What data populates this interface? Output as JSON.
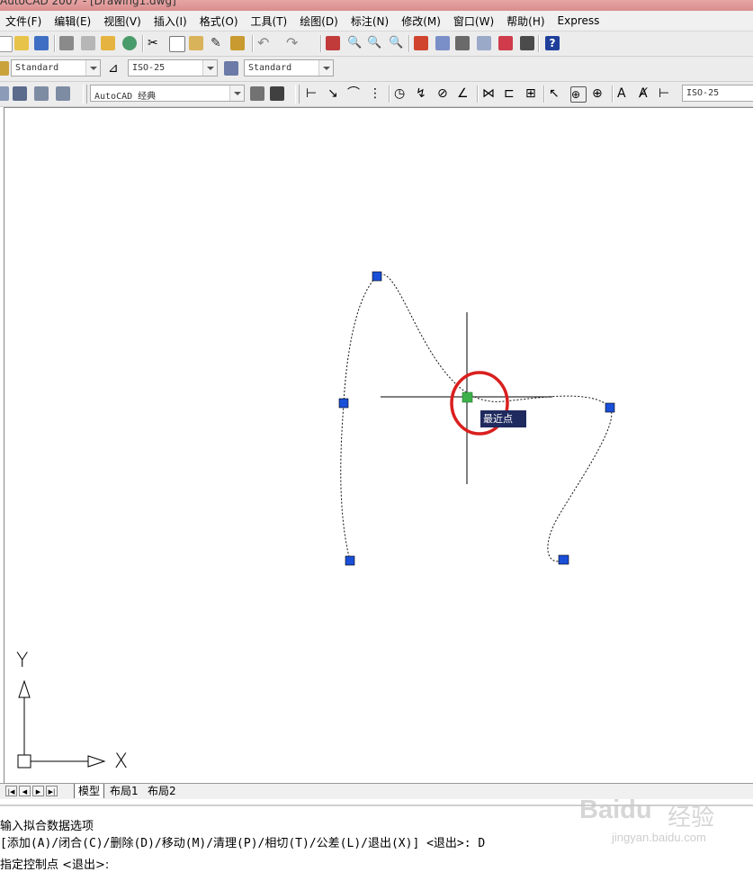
{
  "window": {
    "title": "AutoCAD 2007 - [Drawing1.dwg]"
  },
  "menu": [
    "文件(F)",
    "编辑(E)",
    "视图(V)",
    "插入(I)",
    "格式(O)",
    "工具(T)",
    "绘图(D)",
    "标注(N)",
    "修改(M)",
    "窗口(W)",
    "帮助(H)",
    "Express"
  ],
  "styles_toolbar": {
    "text_style": "Standard",
    "dim_style": "ISO-25",
    "table_style": "Standard"
  },
  "workspaces_toolbar": {
    "workspace": "AutoCAD 经典"
  },
  "dimension_toolbar": {
    "dim_style": "ISO-25"
  },
  "canvas": {
    "snap_tooltip": "最近点",
    "ucs": {
      "x_label": "X",
      "y_label": "Y"
    }
  },
  "layout_tabs": [
    "模型",
    "布局1",
    "布局2"
  ],
  "command_line": {
    "line1": "输入拟合数据选项",
    "line2": "[添加(A)/闭合(C)/删除(D)/移动(M)/清理(P)/相切(T)/公差(L)/退出(X)] <退出>: D",
    "line3": "指定控制点 <退出>:"
  },
  "watermark": {
    "brand": "Baidu",
    "brand_cn": "经验",
    "url": "jingyan.baidu.com"
  },
  "colors": {
    "grip_blue": "#1a4fd8",
    "grip_selected_green": "#3cb04a",
    "highlight_circle": "#d9201f",
    "tooltip_bg": "#1f2a5e"
  }
}
